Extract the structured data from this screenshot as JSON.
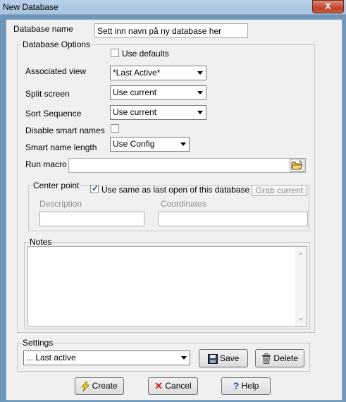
{
  "window": {
    "title": "New Database",
    "close_label": "X"
  },
  "database_name": {
    "label": "Database name",
    "value": "Sett inn navn på ny database her"
  },
  "options": {
    "legend": "Database Options",
    "use_defaults": {
      "label": "Use defaults",
      "checked": false
    },
    "associated_view": {
      "label": "Associated view",
      "value": "*Last Active*"
    },
    "split_screen": {
      "label": "Split screen",
      "value": "Use current"
    },
    "sort_sequence": {
      "label": "Sort Sequence",
      "value": "Use current"
    },
    "disable_smart_names": {
      "label": "Disable smart names",
      "checked": false
    },
    "smart_name_length": {
      "label": "Smart name length",
      "value": "Use Config"
    },
    "run_macro": {
      "label": "Run macro",
      "value": ""
    },
    "center_point": {
      "legend": "Center point",
      "use_same_label": "Use same as last open of this database",
      "use_same_checked": true,
      "grab_current_label": "Grab current",
      "description_label": "Description",
      "coordinates_label": "Coordinates",
      "description_value": "",
      "coordinates_value": ""
    },
    "notes": {
      "legend": "Notes",
      "value": ""
    }
  },
  "settings": {
    "legend": "Settings",
    "value": "... Last active",
    "save_label": "Save",
    "delete_label": "Delete"
  },
  "buttons": {
    "create": "Create",
    "cancel": "Cancel",
    "help": "Help"
  }
}
